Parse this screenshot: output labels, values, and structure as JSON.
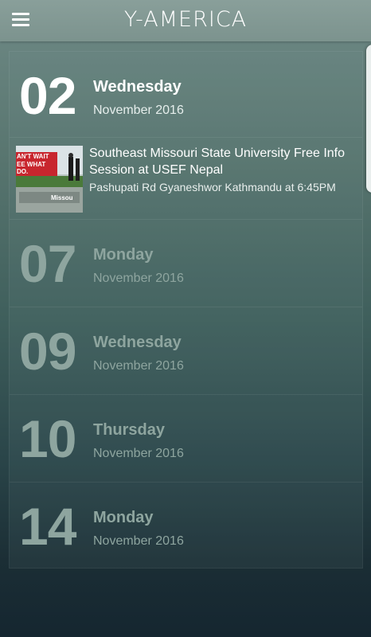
{
  "header": {
    "title": "Y-AMERICA"
  },
  "days": [
    {
      "number": "02",
      "weekday": "Wednesday",
      "monthyear": "November 2016",
      "event": {
        "title": "Southeast Missouri State University Free Info Session at USEF Nepal",
        "location": "Pashupati Rd Gyaneshwor Kathmandu at 6:45PM",
        "image_text_1": "AN'T WAIT",
        "image_text_2": "EE WHAT",
        "image_text_3": "DO.",
        "image_text_4": "Missou"
      }
    },
    {
      "number": "07",
      "weekday": "Monday",
      "monthyear": "November 2016"
    },
    {
      "number": "09",
      "weekday": "Wednesday",
      "monthyear": "November 2016"
    },
    {
      "number": "10",
      "weekday": "Thursday",
      "monthyear": "November 2016"
    },
    {
      "number": "14",
      "weekday": "Monday",
      "monthyear": "November 2016"
    }
  ]
}
